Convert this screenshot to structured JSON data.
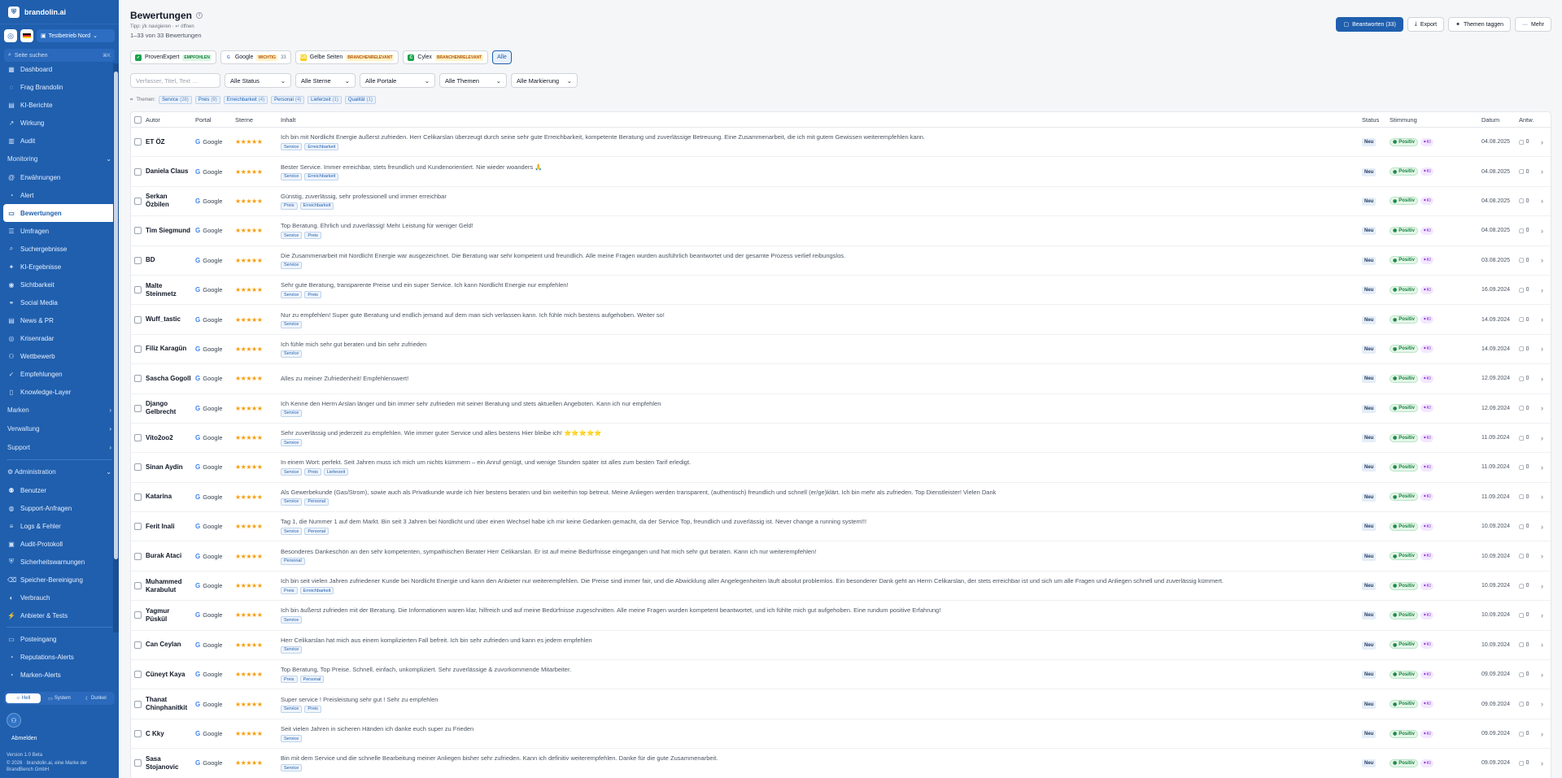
{
  "app": {
    "brand": "brandolin.ai",
    "tenant": "Testbetrieb Nord",
    "search_placeholder": "Seite suchen",
    "search_kbd": "⌘K"
  },
  "sidebar": {
    "items_top": [
      {
        "label": "Dashboard",
        "icon": "grid-icon"
      },
      {
        "label": "Frag Brandolin",
        "icon": "chat-icon"
      },
      {
        "label": "KI-Berichte",
        "icon": "document-icon"
      },
      {
        "label": "Wirkung",
        "icon": "trend-icon"
      },
      {
        "label": "Audit",
        "icon": "audit-icon"
      }
    ],
    "monitoring_label": "Monitoring",
    "monitoring_items": [
      {
        "label": "Erwähnungen",
        "icon": "at-icon"
      },
      {
        "label": "Alert",
        "icon": "bell-icon"
      },
      {
        "label": "Bewertungen",
        "icon": "review-icon",
        "active": true
      },
      {
        "label": "Umfragen",
        "icon": "survey-icon"
      },
      {
        "label": "Suchergebnisse",
        "icon": "search-icon"
      },
      {
        "label": "KI-Ergebnisse",
        "icon": "sparkle-icon"
      },
      {
        "label": "Sichtbarkeit",
        "icon": "eye-icon"
      },
      {
        "label": "Social Media",
        "icon": "social-icon"
      },
      {
        "label": "News & PR",
        "icon": "news-icon"
      },
      {
        "label": "Krisenradar",
        "icon": "radar-icon"
      },
      {
        "label": "Wettbewerb",
        "icon": "users-icon"
      },
      {
        "label": "Empfehlungen",
        "icon": "thumb-icon"
      },
      {
        "label": "Knowledge-Layer",
        "icon": "book-icon"
      }
    ],
    "sections": [
      "Marken",
      "Verwaltung",
      "Support"
    ],
    "admin_label": "Administration",
    "admin_items": [
      {
        "label": "Benutzer",
        "icon": "user-icon"
      },
      {
        "label": "Support-Anfragen",
        "icon": "lifebuoy-icon"
      },
      {
        "label": "Logs & Fehler",
        "icon": "log-icon"
      },
      {
        "label": "Audit-Protokoll",
        "icon": "clipboard-icon"
      },
      {
        "label": "Sicherheitswarnungen",
        "icon": "shield-icon"
      },
      {
        "label": "Speicher-Bereinigung",
        "icon": "trash-icon"
      },
      {
        "label": "Verbrauch",
        "icon": "gauge-icon"
      },
      {
        "label": "Anbieter & Tests",
        "icon": "plug-icon"
      }
    ],
    "bottom_items": [
      {
        "label": "Posteingang",
        "icon": "inbox-icon"
      },
      {
        "label": "Reputations-Alerts",
        "icon": "bell-icon"
      },
      {
        "label": "Marken-Alerts",
        "icon": "bell-icon"
      }
    ],
    "theme": {
      "light": "Hell",
      "system": "System",
      "dark": "Dunkel"
    },
    "logout": "Abmelden",
    "version": "Version 1.0 Beta",
    "copyright": "© 2026 · brandolin.ai, eine Marke der BrandBench GmbH"
  },
  "header": {
    "title": "Bewertungen",
    "tip": "Tipp: j/k navigieren · ↵ öffnen",
    "count": "1–33 von 33 Bewertungen",
    "actions": {
      "reply": "Beantworten (33)",
      "export": "Export",
      "tag": "Themen taggen",
      "more": "Mehr"
    }
  },
  "portals": [
    {
      "name": "ProvenExpert",
      "badge": "EMPFOHLEN",
      "badge_bg": "#dcf5e3",
      "badge_fg": "#15803d",
      "icon_bg": "#16a34a",
      "icon": "✓",
      "count": ""
    },
    {
      "name": "Google",
      "badge": "WICHTIG",
      "badge_bg": "#fef3c7",
      "badge_fg": "#b45309",
      "icon_bg": "#ffffff",
      "icon": "G",
      "count": "33"
    },
    {
      "name": "Gelbe Seiten",
      "badge": "BRANCHENRELEVANT",
      "badge_bg": "#fef3c7",
      "badge_fg": "#b45309",
      "icon_bg": "#facc15",
      "icon": "GS",
      "count": ""
    },
    {
      "name": "Cylex",
      "badge": "BRANCHENRELEVANT",
      "badge_bg": "#fef3c7",
      "badge_fg": "#b45309",
      "icon_bg": "#16a34a",
      "icon": "C",
      "count": ""
    }
  ],
  "portal_all": "Alle",
  "filters": {
    "search_placeholder": "Verfasser, Titel, Text …",
    "status": "Alle Status",
    "stars": "Alle Sterne",
    "portals": "Alle Portale",
    "themes": "Alle Themen",
    "marks": "Alle Markierung"
  },
  "themes_label": "Themen:",
  "themes": [
    {
      "name": "Service",
      "count": "(28)"
    },
    {
      "name": "Preis",
      "count": "(9)"
    },
    {
      "name": "Erreichbarkeit",
      "count": "(4)"
    },
    {
      "name": "Personal",
      "count": "(4)"
    },
    {
      "name": "Lieferzeit",
      "count": "(1)"
    },
    {
      "name": "Qualität",
      "count": "(1)"
    }
  ],
  "table": {
    "headers": {
      "author": "Autor",
      "portal": "Portal",
      "stars": "Sterne",
      "content": "Inhalt",
      "status": "Status",
      "sentiment": "Stimmung",
      "date": "Datum",
      "answers": "Antw."
    },
    "rows": [
      {
        "author": "ET ÖZ",
        "portal": "Google",
        "stars": 5,
        "text": "Ich bin mit Nordlicht Energie äußerst zufrieden. Herr Celikarslan überzeugt durch seine sehr gute Erreichbarkeit, kompetente Beratung und zuverlässige Betreuung. Eine Zusammenarbeit, die ich mit gutem Gewissen weiterempfehlen kann.",
        "tags": [
          "Service",
          "Erreichbarkeit"
        ],
        "status": "Neu",
        "sentiment": "Positiv",
        "ki": "KI",
        "date": "04.08.2025",
        "answers": "0"
      },
      {
        "author": "Daniela Claus",
        "portal": "Google",
        "stars": 5,
        "text": "Bester Service. Immer erreichbar, stets freundlich und Kundenorientiert. Nie wieder woanders 🙏",
        "tags": [
          "Service",
          "Erreichbarkeit"
        ],
        "status": "Neu",
        "sentiment": "Positiv",
        "ki": "KI",
        "date": "04.08.2025",
        "answers": "0"
      },
      {
        "author": "Serkan Özbilen",
        "portal": "Google",
        "stars": 5,
        "text": "Günstig, zuverlässig, sehr professionell und immer erreichbar",
        "tags": [
          "Preis",
          "Erreichbarkeit"
        ],
        "status": "Neu",
        "sentiment": "Positiv",
        "ki": "KI",
        "date": "04.08.2025",
        "answers": "0"
      },
      {
        "author": "Tim Siegmund",
        "portal": "Google",
        "stars": 5,
        "text": "Top Beratung. Ehrlich und zuverlässig! Mehr Leistung für weniger Geld!",
        "tags": [
          "Service",
          "Preis"
        ],
        "status": "Neu",
        "sentiment": "Positiv",
        "ki": "KI",
        "date": "04.08.2025",
        "answers": "0"
      },
      {
        "author": "BD",
        "portal": "Google",
        "stars": 5,
        "text": "Die Zusammenarbeit mit Nordlicht Energie war ausgezeichnet. Die Beratung war sehr kompetent und freundlich. Alle meine Fragen wurden ausführlich beantwortet und der gesamte Prozess verlief reibungslos.",
        "tags": [
          "Service"
        ],
        "status": "Neu",
        "sentiment": "Positiv",
        "ki": "KI",
        "date": "03.08.2025",
        "answers": "0"
      },
      {
        "author": "Malte Steinmetz",
        "portal": "Google",
        "stars": 5,
        "text": "Sehr gute Beratung, transparente Preise und ein super Service. Ich kann Nordlicht Energie nur empfehlen!",
        "tags": [
          "Service",
          "Preis"
        ],
        "status": "Neu",
        "sentiment": "Positiv",
        "ki": "KI",
        "date": "16.09.2024",
        "answers": "0"
      },
      {
        "author": "Wuff_tastic",
        "portal": "Google",
        "stars": 5,
        "text": "Nur zu empfehlen! Super gute Beratung und endlich jemand auf dem man sich verlassen kann. Ich fühle mich bestens aufgehoben. Weiter so!",
        "tags": [
          "Service"
        ],
        "status": "Neu",
        "sentiment": "Positiv",
        "ki": "KI",
        "date": "14.09.2024",
        "answers": "0"
      },
      {
        "author": "Filiz Karagün",
        "portal": "Google",
        "stars": 5,
        "text": "Ich fühle mich sehr gut beraten und bin sehr zufrieden",
        "tags": [
          "Service"
        ],
        "status": "Neu",
        "sentiment": "Positiv",
        "ki": "KI",
        "date": "14.09.2024",
        "answers": "0"
      },
      {
        "author": "Sascha Gogoll",
        "portal": "Google",
        "stars": 5,
        "text": "Alles zu meiner Zufriedenheit! Empfehlenswert!",
        "tags": [],
        "status": "Neu",
        "sentiment": "Positiv",
        "ki": "KI",
        "date": "12.09.2024",
        "answers": "0"
      },
      {
        "author": "Django Gelbrecht",
        "portal": "Google",
        "stars": 5,
        "text": "Ich Kenne den Herrn Arslan länger und bin immer sehr zufrieden mit seiner Beratung und stets aktuellen Angeboten. Kann ich nur empfehlen",
        "tags": [
          "Service"
        ],
        "status": "Neu",
        "sentiment": "Positiv",
        "ki": "KI",
        "date": "12.09.2024",
        "answers": "0"
      },
      {
        "author": "Vito2oo2",
        "portal": "Google",
        "stars": 5,
        "text": "Sehr zuverlässig und jederzeit zu empfehlen. Wie immer guter Service und alles bestens Hier bleibe ich! ⭐⭐⭐⭐⭐",
        "tags": [
          "Service"
        ],
        "status": "Neu",
        "sentiment": "Positiv",
        "ki": "KI",
        "date": "11.09.2024",
        "answers": "0"
      },
      {
        "author": "Sinan Aydin",
        "portal": "Google",
        "stars": 5,
        "text": "In einem Wort: perfekt. Seit Jahren muss ich mich um nichts kümmern – ein Anruf genügt, und wenige Stunden später ist alles zum besten Tarif erledigt.",
        "tags": [
          "Service",
          "Preis",
          "Lieferzeit"
        ],
        "status": "Neu",
        "sentiment": "Positiv",
        "ki": "KI",
        "date": "11.09.2024",
        "answers": "0"
      },
      {
        "author": "Katarina",
        "portal": "Google",
        "stars": 5,
        "text": "Als Gewerbekunde (Gas/Strom), sowie auch als Privatkunde wurde ich hier bestens beraten und bin weiterhin top betreut. Meine Anliegen werden transparent, (authentisch) freundlich und schnell (er/ge)klärt. Ich bin mehr als zufrieden. Top Dienstleister! Vielen Dank",
        "tags": [
          "Service",
          "Personal"
        ],
        "status": "Neu",
        "sentiment": "Positiv",
        "ki": "KI",
        "date": "11.09.2024",
        "answers": "0"
      },
      {
        "author": "Ferit Inali",
        "portal": "Google",
        "stars": 5,
        "text": "Tag 1, die Nummer 1 auf dem Markt. Bin seit 3 Jahren bei Nordlicht und über einen Wechsel habe ich mir keine Gedanken gemacht, da der Service Top, freundlich und zuverlässig ist. Never change a running system!!!",
        "tags": [
          "Service",
          "Personal"
        ],
        "status": "Neu",
        "sentiment": "Positiv",
        "ki": "KI",
        "date": "10.09.2024",
        "answers": "0"
      },
      {
        "author": "Burak Ataci",
        "portal": "Google",
        "stars": 5,
        "text": "Besonderes Dankeschön an den sehr kompetenten, sympathischen Berater Herr Celikarslan. Er ist auf meine Bedürfnisse eingegangen und hat mich sehr gut beraten. Kann ich nur weiterempfehlen!",
        "tags": [
          "Personal"
        ],
        "status": "Neu",
        "sentiment": "Positiv",
        "ki": "KI",
        "date": "10.09.2024",
        "answers": "0"
      },
      {
        "author": "Muhammed Karabulut",
        "portal": "Google",
        "stars": 5,
        "text": "Ich bin seit vielen Jahren zufriedener Kunde bei Nordlicht Energie und kann den Anbieter nur weiterempfehlen. Die Preise sind immer fair, und die Abwicklung aller Angelegenheiten läuft absolut problemlos. Ein besonderer Dank geht an Herrn Celikarslan, der stets erreichbar ist und sich um alle Fragen und Anliegen schnell und zuverlässig kümmert.",
        "tags": [
          "Preis",
          "Erreichbarkeit"
        ],
        "status": "Neu",
        "sentiment": "Positiv",
        "ki": "KI",
        "date": "10.09.2024",
        "answers": "0"
      },
      {
        "author": "Yagmur Püskül",
        "portal": "Google",
        "stars": 5,
        "text": "Ich bin äußerst zufrieden mit der Beratung. Die Informationen waren klar, hilfreich und auf meine Bedürfnisse zugeschnitten. Alle meine Fragen wurden kompetent beantwortet, und ich fühlte mich gut aufgehoben. Eine rundum positive Erfahrung!",
        "tags": [
          "Service"
        ],
        "status": "Neu",
        "sentiment": "Positiv",
        "ki": "KI",
        "date": "10.09.2024",
        "answers": "0"
      },
      {
        "author": "Can Ceylan",
        "portal": "Google",
        "stars": 5,
        "text": "Herr Celikarslan hat mich aus einem komplizierten Fall befreit. Ich bin sehr zufrieden und kann es jedem empfehlen",
        "tags": [
          "Service"
        ],
        "status": "Neu",
        "sentiment": "Positiv",
        "ki": "KI",
        "date": "10.09.2024",
        "answers": "0"
      },
      {
        "author": "Cüneyt Kaya",
        "portal": "Google",
        "stars": 5,
        "text": "Top Beratung, Top Preise. Schnell, einfach, unkompliziert. Sehr zuverlässige & zuvorkommende Mitarbeiter.",
        "tags": [
          "Preis",
          "Personal"
        ],
        "status": "Neu",
        "sentiment": "Positiv",
        "ki": "KI",
        "date": "09.09.2024",
        "answers": "0"
      },
      {
        "author": "Thanat Chinphanitkit",
        "portal": "Google",
        "stars": 5,
        "text": "Super service ! Preisleistung sehr gut ! Sehr zu empfehlen",
        "tags": [
          "Service",
          "Preis"
        ],
        "status": "Neu",
        "sentiment": "Positiv",
        "ki": "KI",
        "date": "09.09.2024",
        "answers": "0"
      },
      {
        "author": "C Kky",
        "portal": "Google",
        "stars": 5,
        "text": "Seit vielen Jahren in sicheren Händen ich danke euch super zu Frieden",
        "tags": [
          "Service"
        ],
        "status": "Neu",
        "sentiment": "Positiv",
        "ki": "KI",
        "date": "09.09.2024",
        "answers": "0"
      },
      {
        "author": "Sasa Stojanovic",
        "portal": "Google",
        "stars": 5,
        "text": "Bin mit dem Service und die schnelle Bearbeitung meiner Anliegen bisher sehr zufrieden. Kann ich definitiv weiterempfehlen. Danke für die gute Zusammenarbeit.",
        "tags": [
          "Service"
        ],
        "status": "Neu",
        "sentiment": "Positiv",
        "ki": "KI",
        "date": "09.09.2024",
        "answers": "0"
      }
    ]
  }
}
